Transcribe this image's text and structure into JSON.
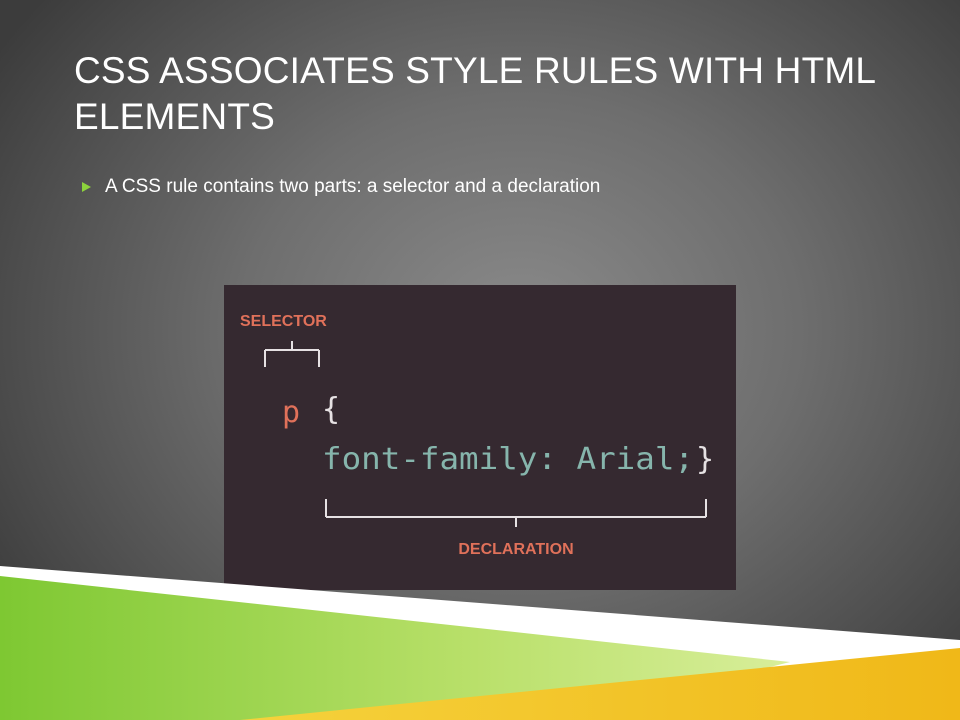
{
  "slide": {
    "title": "CSS Associates Style Rules with HTML Elements",
    "bullets": [
      {
        "text": "A CSS rule contains two parts: a selector and a declaration"
      }
    ]
  },
  "figure": {
    "selector_label": "SELECTOR",
    "declaration_label": "DECLARATION",
    "code_selector": "p",
    "code_open_brace": "{",
    "code_declaration": "font-family: Arial;",
    "code_close_brace": "}",
    "colors": {
      "background": "#352930",
      "label": "#e0715a",
      "declaration": "#86b5ac",
      "brace": "#e6e1e3"
    }
  },
  "theme": {
    "accent_green": "#8cd23c",
    "accent_yellow": "#f0c020"
  }
}
